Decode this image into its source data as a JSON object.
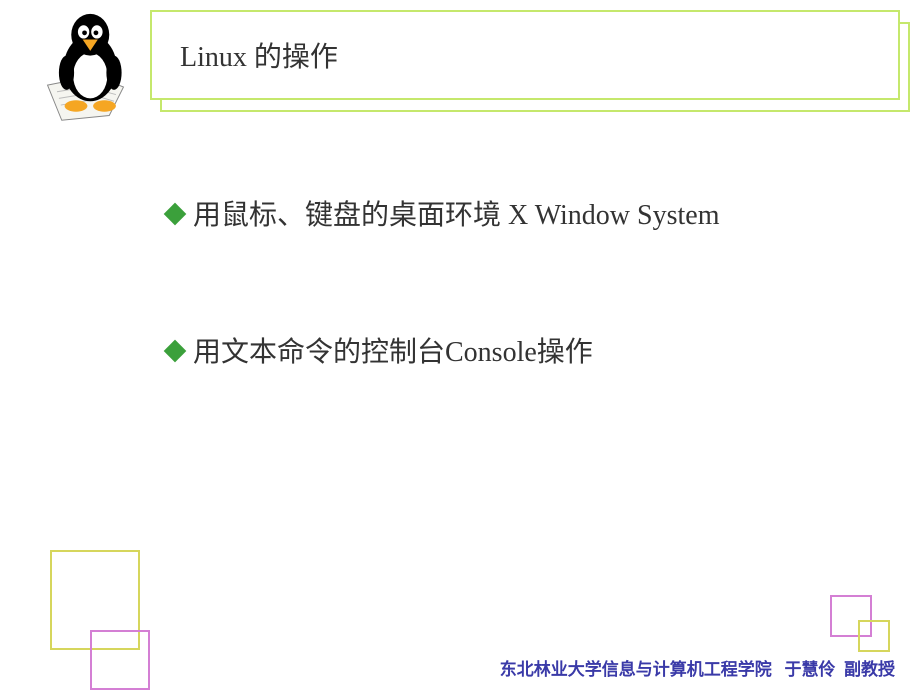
{
  "title": "Linux 的操作",
  "bullets": [
    "用鼠标、键盘的桌面环境 X Window System",
    "用文本命令的控制台Console操作"
  ],
  "footer": {
    "institution": "东北林业大学信息与计算机工程学院",
    "author": "于慧伶",
    "title_rank": "副教授"
  }
}
